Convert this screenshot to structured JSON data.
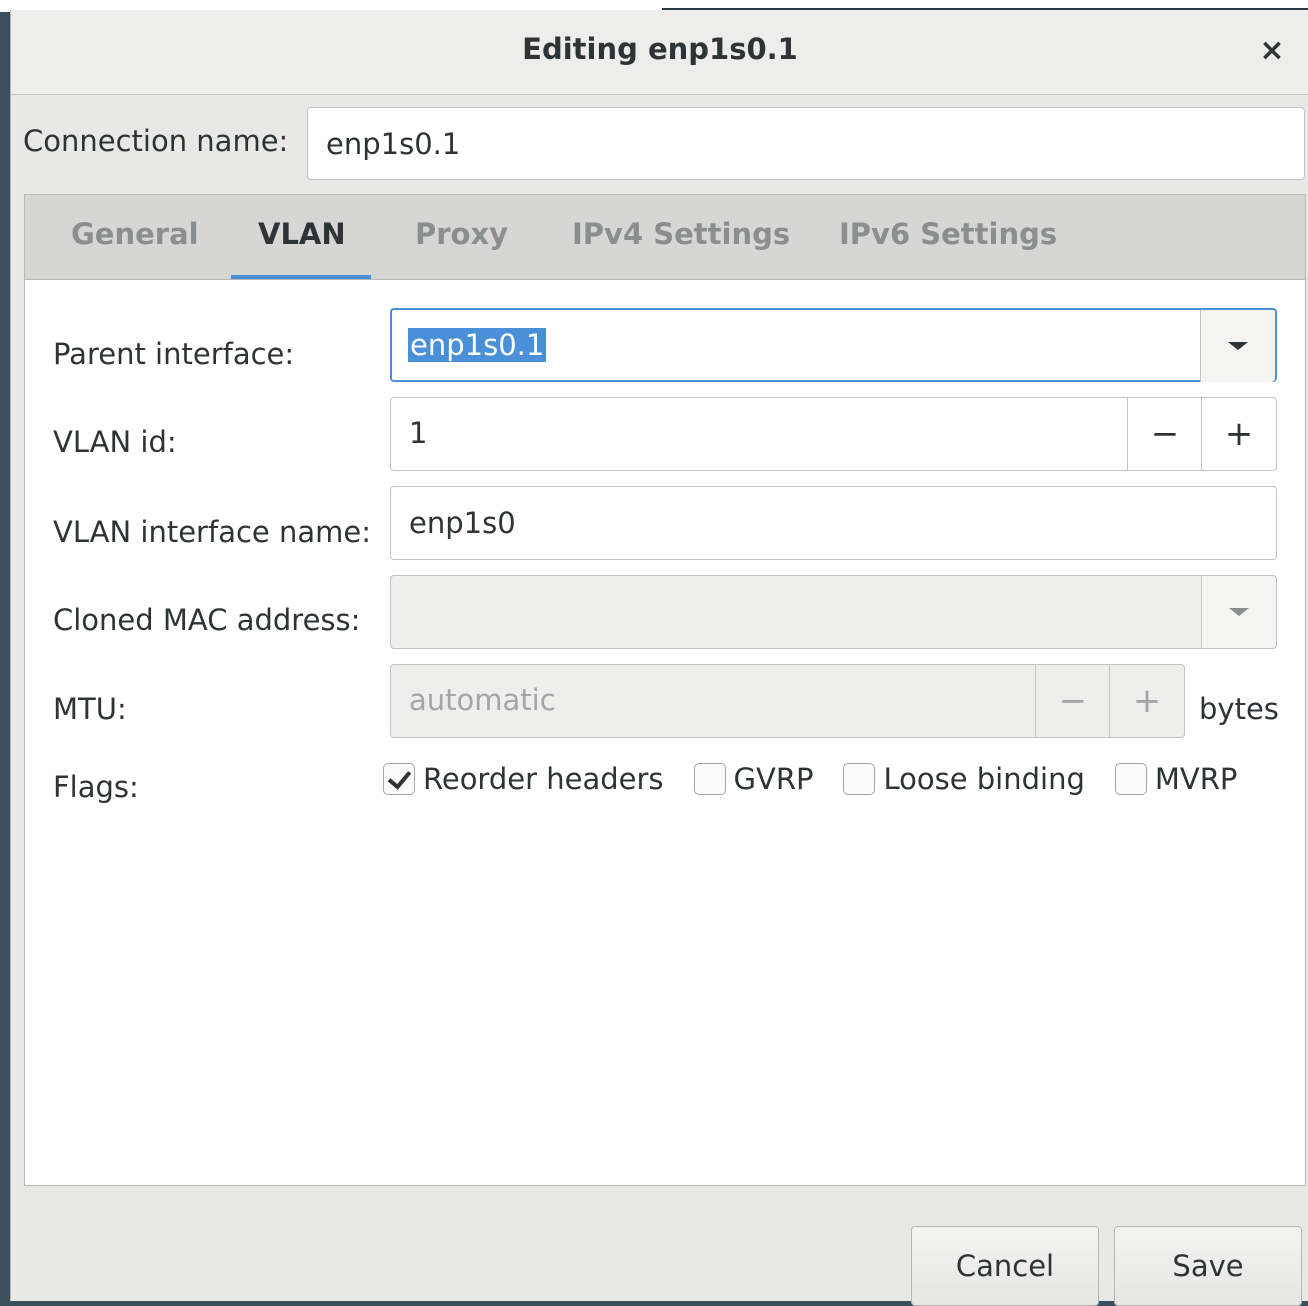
{
  "dialog": {
    "title": "Editing enp1s0.1",
    "close_glyph": "×",
    "connection_name_label": "Connection name:",
    "connection_name_value": "enp1s0.1"
  },
  "tabs": [
    {
      "label": "General",
      "active": false
    },
    {
      "label": "VLAN",
      "active": true
    },
    {
      "label": "Proxy",
      "active": false
    },
    {
      "label": "IPv4 Settings",
      "active": false
    },
    {
      "label": "IPv6 Settings",
      "active": false
    }
  ],
  "vlan": {
    "parent_interface_label": "Parent interface:",
    "parent_interface_value": "enp1s0.1",
    "vlan_id_label": "VLAN id:",
    "vlan_id_value": "1",
    "vlan_interface_name_label": "VLAN interface name:",
    "vlan_interface_name_value": "enp1s0",
    "cloned_mac_label": "Cloned MAC address:",
    "cloned_mac_value": "",
    "mtu_label": "MTU:",
    "mtu_value": "automatic",
    "mtu_unit": "bytes",
    "flags_label": "Flags:",
    "flags": [
      {
        "label": "Reorder headers",
        "checked": true
      },
      {
        "label": "GVRP",
        "checked": false
      },
      {
        "label": "Loose binding",
        "checked": false
      },
      {
        "label": "MVRP",
        "checked": false
      }
    ],
    "minus_glyph": "−",
    "plus_glyph": "+"
  },
  "buttons": {
    "cancel": "Cancel",
    "save": "Save"
  },
  "colors": {
    "accent": "#4a90d9",
    "dialog_bg": "#e8e8e7",
    "tabbar_bg": "#d6d6d4"
  }
}
